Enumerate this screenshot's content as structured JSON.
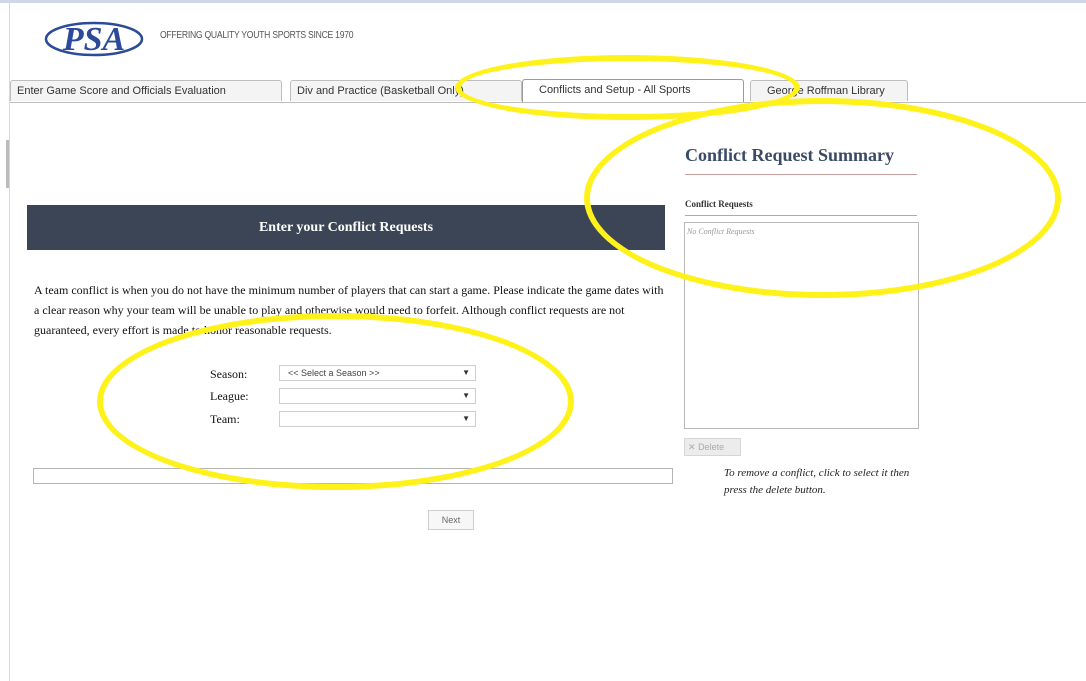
{
  "logo": {
    "text": "PSA"
  },
  "tagline": "OFFERING QUALITY YOUTH SPORTS SINCE 1970",
  "tabs": [
    {
      "label": "Enter Game Score and Officials Evaluation",
      "active": false
    },
    {
      "label": "Div and Practice (Basketball Only)",
      "active": false
    },
    {
      "label": "Conflicts and Setup - All Sports",
      "active": true
    },
    {
      "label": "George Roffman Library",
      "active": false
    }
  ],
  "main": {
    "header": "Enter your Conflict Requests",
    "description": "A team conflict is when you do not have the minimum number of players that can start a game. Please indicate the game dates with a clear reason why your team will be unable to play and otherwise would need to forfeit. Although conflict requests are not guaranteed, every effort is made to honor reasonable requests.",
    "form": {
      "season_label": "Season:",
      "season_value": "<< Select a Season >>",
      "league_label": "League:",
      "league_value": "",
      "team_label": "Team:",
      "team_value": ""
    },
    "next_label": "Next"
  },
  "summary": {
    "title": "Conflict Request Summary",
    "requests_label": "Conflict Requests",
    "empty_text": "No Conflict Requests",
    "delete_label": "Delete",
    "note": "To remove a conflict, click to select it then press the delete button."
  },
  "colors": {
    "header_bg": "#3b4555",
    "summary_title": "#3b4a66",
    "highlight": "#fff21a",
    "logo_blue": "#2b4a9a"
  },
  "icons": {
    "dropdown": "chevron-down-icon",
    "delete": "close-icon"
  }
}
